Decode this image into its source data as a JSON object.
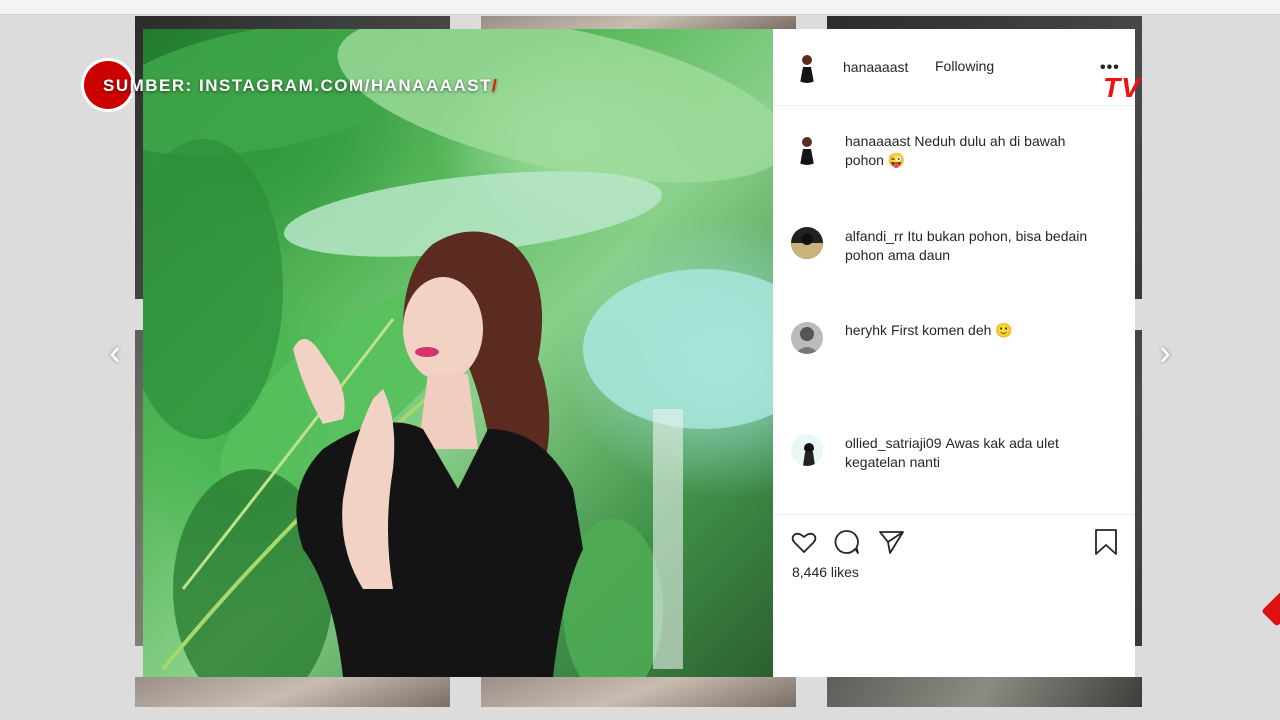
{
  "overlay": {
    "source_label": "SUMBER: INSTAGRAM.COM/HANAAAAST",
    "slash": "/",
    "tv_logo": "TV"
  },
  "nav": {
    "prev_icon": "‹",
    "next_icon": "›"
  },
  "post": {
    "username": "hanaaaast",
    "follow_status": "Following",
    "more_icon": "•••",
    "likes": "8,446 likes"
  },
  "comments": [
    {
      "user": "hanaaaast",
      "text": "Neduh dulu ah di bawah pohon 😜"
    },
    {
      "user": "alfandi_rr",
      "text": "Itu bukan pohon, bisa bedain pohon ama daun"
    },
    {
      "user": "heryhk",
      "text": "First komen deh 🙂"
    },
    {
      "user": "ollied_satriaji09",
      "text": "Awas kak ada ulet kegatelan nanti"
    }
  ],
  "icons": {
    "like": "heart-icon",
    "comment": "comment-icon",
    "share": "share-icon",
    "save": "bookmark-icon"
  },
  "colors": {
    "accent_red": "#cc0000",
    "text": "#262626"
  }
}
